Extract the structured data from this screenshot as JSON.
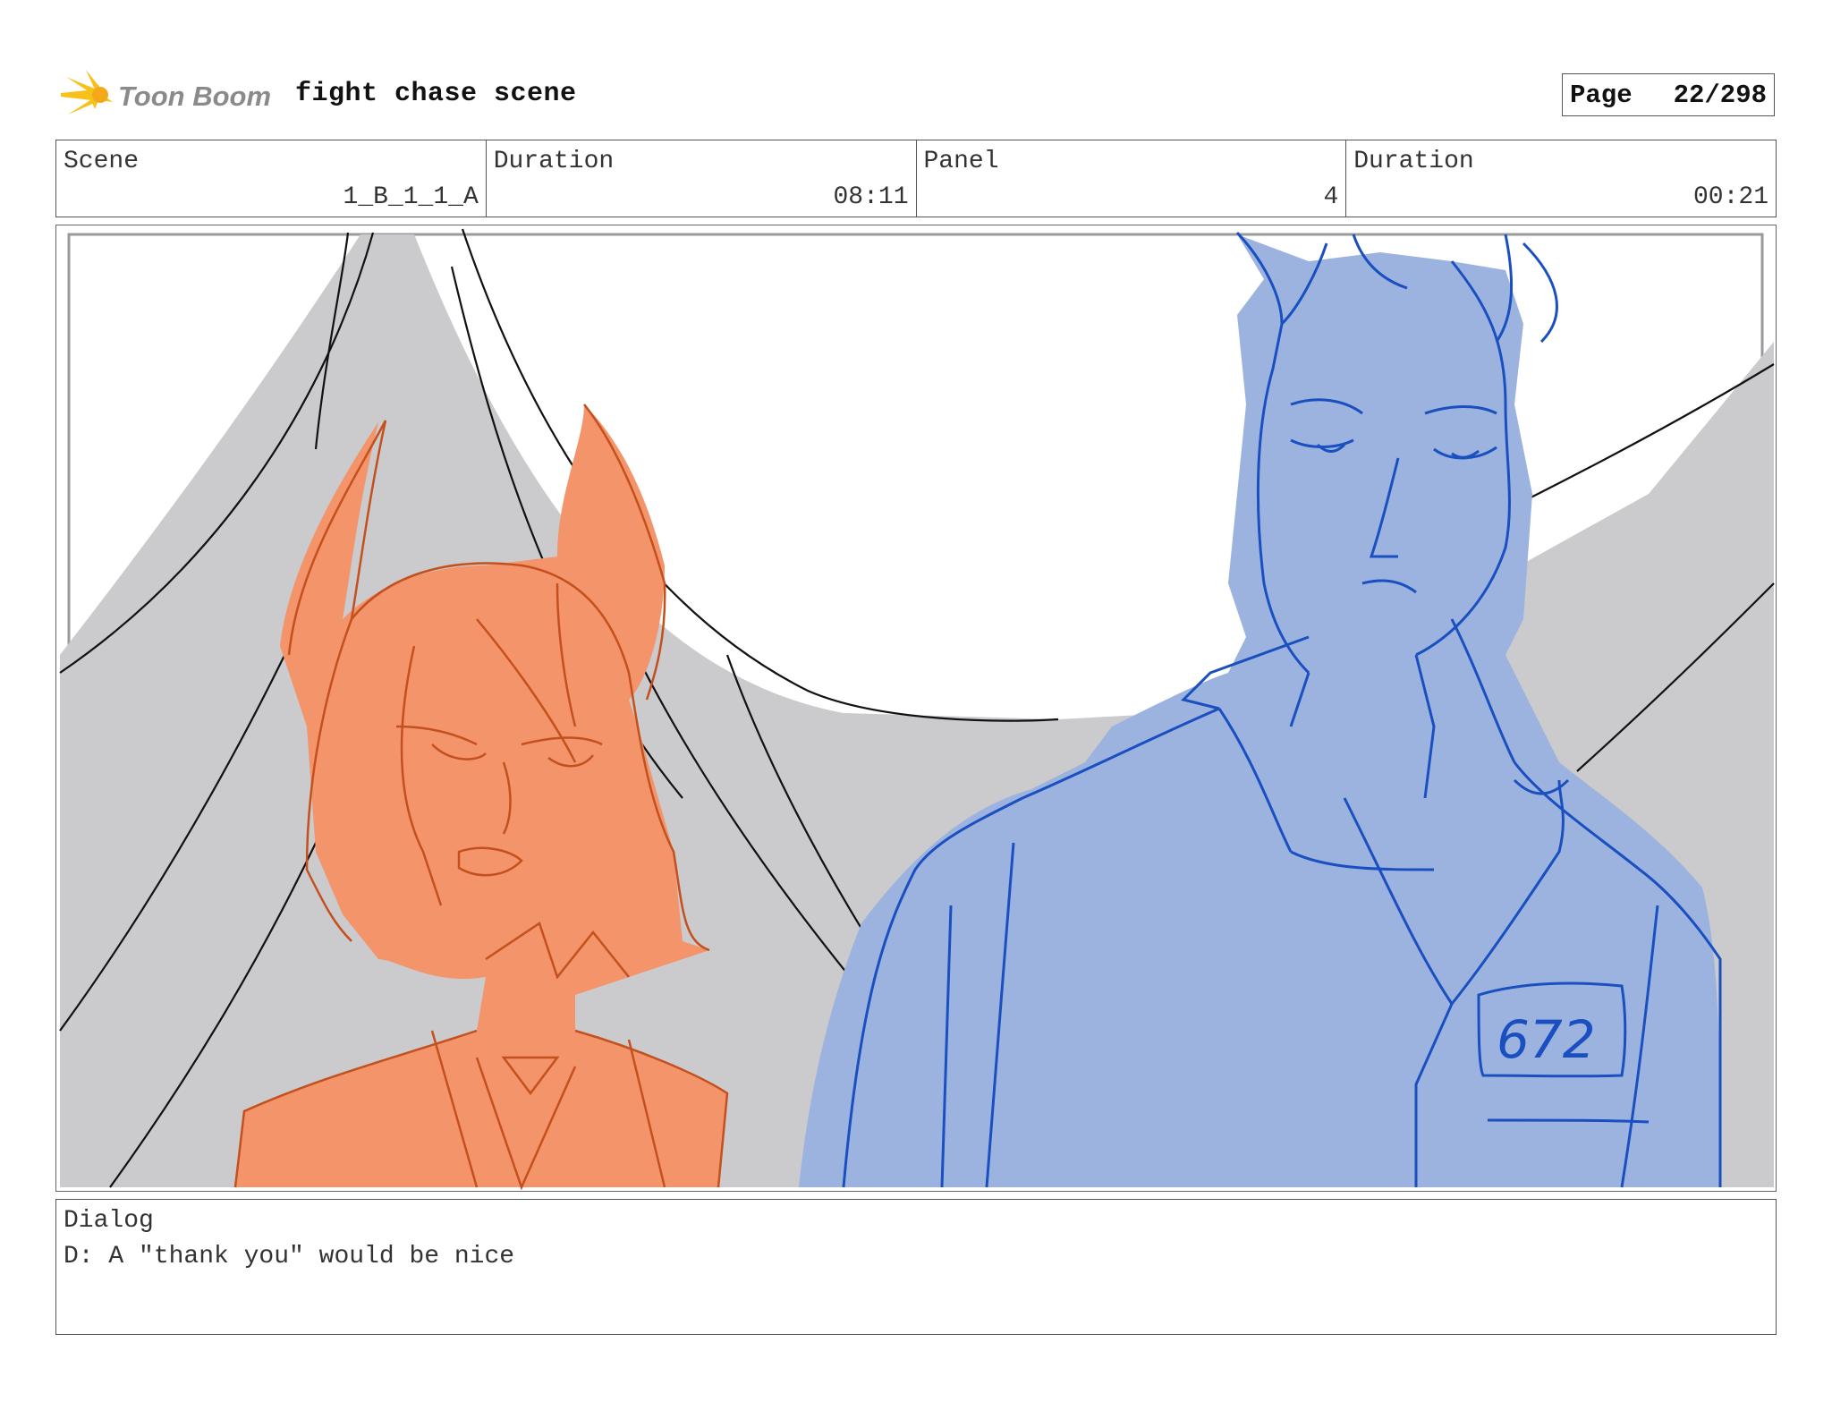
{
  "header": {
    "brand": "Toon Boom",
    "project_title": "fight chase scene",
    "page_label": "Page",
    "page_value": "22/298"
  },
  "info": {
    "scene_label": "Scene",
    "scene_value": "1_B_1_1_A",
    "scene_duration_label": "Duration",
    "scene_duration_value": "08:11",
    "panel_label": "Panel",
    "panel_value": "4",
    "panel_duration_label": "Duration",
    "panel_duration_value": "00:21"
  },
  "panel": {
    "badge_number": "672",
    "colors": {
      "tent": "#cbcacc",
      "girl_fill": "#f4946a",
      "girl_line": "#c4501e",
      "boy_fill": "#9cb3df",
      "boy_line": "#1a4fc0"
    }
  },
  "dialog": {
    "label": "Dialog",
    "text": "D: A \"thank you\" would be nice"
  }
}
